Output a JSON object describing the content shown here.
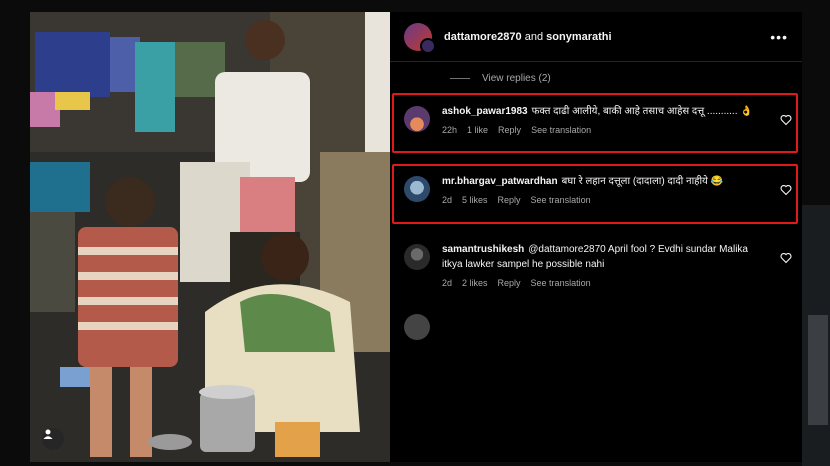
{
  "header": {
    "user1": "dattamore2870",
    "joiner": "and",
    "user2": "sonymarathi",
    "more_icon": "more-horizontal-icon"
  },
  "view_replies": "View replies (2)",
  "comments": [
    {
      "username": "ashok_pawar1983",
      "text": "फक्त दाढी आलीये, बाकी आहे तसाच आहेस दत्तू ........... 👌",
      "time": "22h",
      "likes": "1 like",
      "reply": "Reply",
      "translate": "See translation"
    },
    {
      "username": "mr.bhargav_patwardhan",
      "text": "बघा रे लहान दत्तूला (दादाला) दादी नाहीये 😂",
      "time": "2d",
      "likes": "5 likes",
      "reply": "Reply",
      "translate": "See translation"
    },
    {
      "username": "samantrushikesh",
      "text": "@dattamore2870 April fool ? Evdhi sundar Malika itkya lawker sampel he possible nahi",
      "time": "2d",
      "likes": "2 likes",
      "reply": "Reply",
      "translate": "See translation"
    }
  ],
  "colors": {
    "highlight": "#e01a1a",
    "meta": "#a8a8a8"
  }
}
